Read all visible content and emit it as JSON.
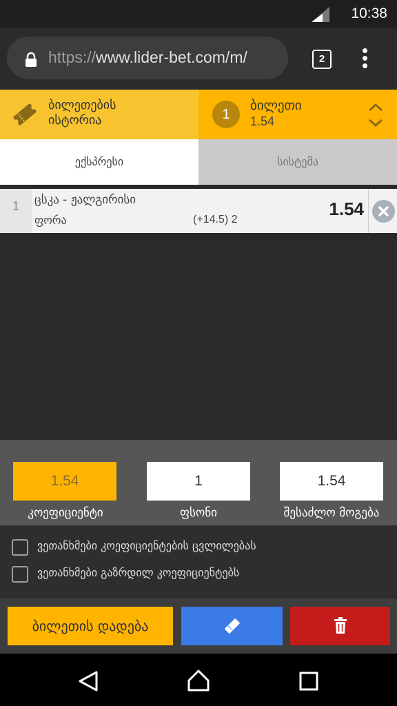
{
  "status_bar": {
    "time": "10:38"
  },
  "browser": {
    "url_scheme": "https://",
    "url_rest": "www.lider-bet.com/m/",
    "tab_count": "2",
    "icons": [
      "lock-icon",
      "menu-icon"
    ]
  },
  "header": {
    "history_label": "ბილეთების ისტორია",
    "ticket_count": "1",
    "ticket_title": "ბილეთი",
    "ticket_odds": "1.54",
    "icons": [
      "ticket-icon",
      "chevron-updown-icon"
    ]
  },
  "tabs": {
    "express": "ექსპრესი",
    "system": "სისტემა"
  },
  "bets": [
    {
      "index": "1",
      "match": "ცსკა - ჟალგირისი",
      "market": "ფორა",
      "parameter": "(+14.5) 2",
      "odds": "1.54"
    }
  ],
  "summary": {
    "odds_value": "1.54",
    "odds_label": "კოეფიციენტი",
    "stake_value": "1",
    "stake_label": "ფსონი",
    "win_value": "1.54",
    "win_label": "შესაძლო მოგება"
  },
  "options": {
    "accept_changes": "ვეთანხმები კოეფიციენტების ცვლილებას",
    "accept_increased": "ვეთანხმები გაზრდილ კოეფიციენტებს"
  },
  "actions": {
    "place_bet": "ბილეთის დადება",
    "icons": [
      "ticket-share-icon",
      "trash-icon"
    ]
  },
  "colors": {
    "accent": "#ffb400",
    "history_bg": "#f7c42f",
    "share": "#3b7be8",
    "delete": "#c41b1b"
  }
}
